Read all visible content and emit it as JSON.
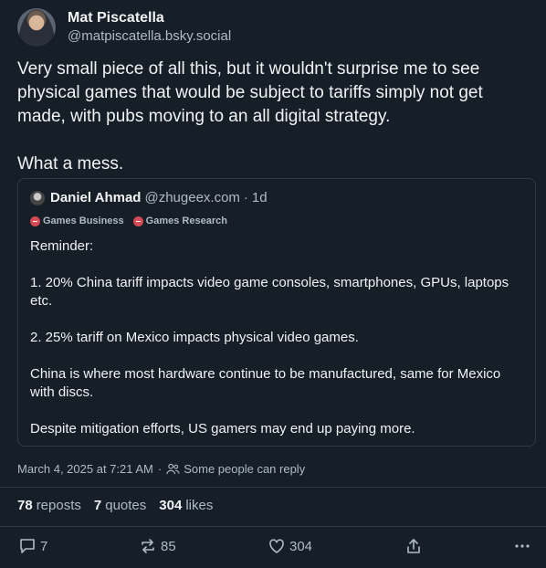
{
  "author": {
    "display_name": "Mat Piscatella",
    "handle": "@matpiscatella.bsky.social"
  },
  "post_text": "Very small piece of all this, but it wouldn't surprise me to see physical games that would be subject to tariffs simply not get made, with pubs moving to an all digital strategy.\n\nWhat a mess.",
  "quote": {
    "display_name": "Daniel Ahmad",
    "handle": "@zhugeex.com",
    "separator": "·",
    "time": "1d",
    "labels": [
      "Games Business",
      "Games Research"
    ],
    "text": "Reminder:\n\n1. 20% China tariff impacts video game consoles, smartphones, GPUs, laptops etc.\n\n2. 25% tariff on Mexico impacts physical video games.\n\nChina is where most hardware continue to be manufactured, same for Mexico with discs.\n\nDespite mitigation efforts, US gamers may end up paying more."
  },
  "meta": {
    "timestamp": "March 4, 2025 at 7:21 AM",
    "separator": "·",
    "reply_setting": "Some people can reply"
  },
  "stats": {
    "reposts_count": "78",
    "reposts_label": "reposts",
    "quotes_count": "7",
    "quotes_label": "quotes",
    "likes_count": "304",
    "likes_label": "likes"
  },
  "actions": {
    "reply_count": "7",
    "repost_count": "85",
    "like_count": "304"
  },
  "icons": {
    "reply": "reply-icon",
    "repost": "repost-icon",
    "like": "heart-icon",
    "share": "share-icon",
    "more": "more-icon"
  },
  "colors": {
    "background": "#161e27",
    "label_dot": "#d54a55",
    "muted_text": "#aebbc9"
  }
}
